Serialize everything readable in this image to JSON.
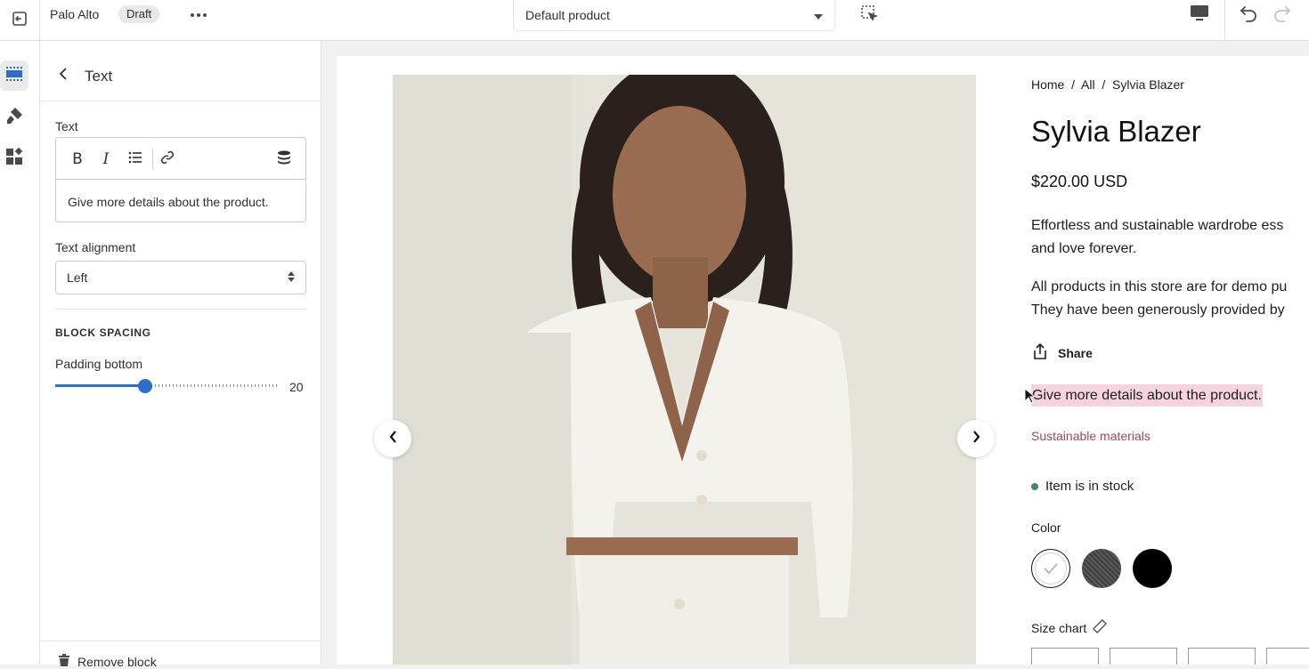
{
  "topbar": {
    "store_name": "Palo Alto",
    "status_badge": "Draft",
    "template_select": "Default product",
    "icons": [
      "exit-icon",
      "more-icon",
      "chevron-down-icon",
      "inspector-icon",
      "desktop-icon",
      "undo-icon",
      "redo-icon"
    ]
  },
  "rail": {
    "items": [
      "sections-icon",
      "theme-settings-icon",
      "apps-icon"
    ],
    "active_index": 0
  },
  "panel": {
    "title": "Text",
    "text_label": "Text",
    "editor_tools": [
      "bold",
      "italic",
      "bulleted-list",
      "link",
      "dynamic-source"
    ],
    "bold_glyph": "B",
    "italic_glyph": "I",
    "editor_content": "Give more details about the product.",
    "alignment_label": "Text alignment",
    "alignment_value": "Left",
    "section_heading": "BLOCK SPACING",
    "padding_label": "Padding bottom",
    "padding_value": "20",
    "padding_fraction": 0.4,
    "remove_label": "Remove block"
  },
  "product": {
    "breadcrumb": "Home  /  All  /  Sylvia Blazer",
    "title": "Sylvia Blazer",
    "price": "$220.00 USD",
    "description_line1": "Effortless and sustainable wardrobe ess",
    "description_line2": "and love forever.",
    "demo_line1": "All products in this store are for demo pu",
    "demo_line2": "They have been generously provided by",
    "share_label": "Share",
    "selected_text": "Give more details about the product.",
    "sustainable_label": "Sustainable materials",
    "stock_label": "Item is in stock",
    "color_label": "Color",
    "swatches": [
      {
        "name": "swatch-white",
        "color": "#ffffff"
      },
      {
        "name": "swatch-charcoal",
        "color": "#4a4a4a"
      },
      {
        "name": "swatch-black",
        "color": "#000000"
      }
    ],
    "size_label": "Size chart"
  },
  "colors": {
    "accent": "#2c6ecb",
    "highlight": "#f7d3df",
    "stock_green": "#3e8c61",
    "sustainable_red": "#9b4a57"
  }
}
